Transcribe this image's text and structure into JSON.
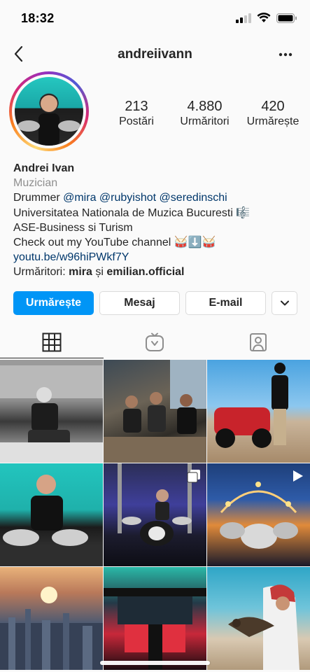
{
  "status": {
    "time": "18:32"
  },
  "nav": {
    "username": "andreiivann"
  },
  "stats": [
    {
      "value": "213",
      "label": "Postări"
    },
    {
      "value": "4.880",
      "label": "Urmăritori"
    },
    {
      "value": "420",
      "label": "Urmărește"
    }
  ],
  "bio": {
    "name": "Andrei Ivan",
    "category": "Muzician",
    "line1_prefix": "Drummer ",
    "mention1": "@mira",
    "mention2": "@rubyishot",
    "mention3": "@seredinschi",
    "line2": "Universitatea Nationala de Muzica Bucuresti 🎼",
    "line3": "ASE-Business si Turism",
    "line4": "Check out my YouTube channel 🥁⬇️🥁",
    "link": "youtu.be/w96hiPWkf7Y",
    "followed_prefix": "Urmăritori: ",
    "followed_user1": "mira",
    "followed_sep": " și ",
    "followed_user2": "emilian.official"
  },
  "buttons": {
    "follow": "Urmărește",
    "message": "Mesaj",
    "email": "E-mail"
  },
  "tabs": [
    {
      "name": "grid-icon",
      "active": true
    },
    {
      "name": "igtv-icon",
      "active": false
    },
    {
      "name": "tagged-icon",
      "active": false
    }
  ],
  "posts": [
    {
      "id": 1,
      "badge": ""
    },
    {
      "id": 2,
      "badge": ""
    },
    {
      "id": 3,
      "badge": ""
    },
    {
      "id": 4,
      "badge": ""
    },
    {
      "id": 5,
      "badge": "carousel-icon"
    },
    {
      "id": 6,
      "badge": "video-icon"
    },
    {
      "id": 7,
      "badge": ""
    },
    {
      "id": 8,
      "badge": ""
    },
    {
      "id": 9,
      "badge": ""
    }
  ],
  "colors": {
    "accent": "#0095f6",
    "link": "#00376b",
    "text": "#262626",
    "secondary": "#8e8e8e"
  }
}
